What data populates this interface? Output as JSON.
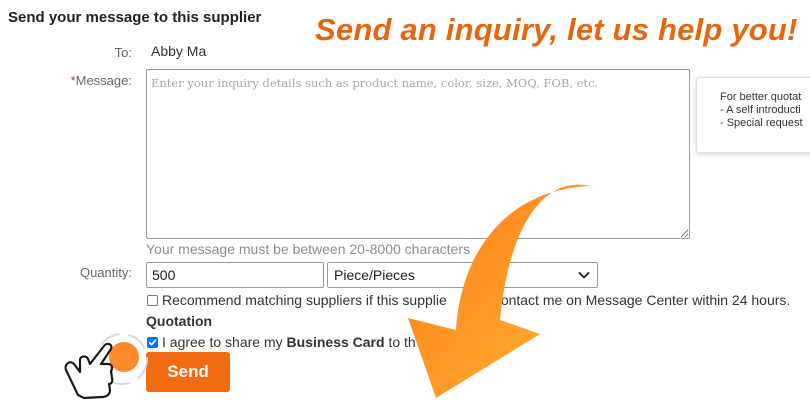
{
  "form": {
    "heading": "Send your message to this supplier",
    "to_label": "To:",
    "to_value": "Abby Ma",
    "message_required_mark": "*",
    "message_label": "Message:",
    "message_placeholder": "Enter your inquiry details such as product name, color, size, MOQ, FOB, etc.",
    "message_hint": "Your message must be between 20-8000 characters",
    "quantity_label": "Quantity:",
    "quantity_value": "500",
    "unit_selected": "Piece/Pieces",
    "recommend_checked": false,
    "recommend_text_1": "Recommend matching suppliers if this supplie",
    "recommend_text_2": "contact me on Message Center within 24 hours.",
    "quotation_title": "Quotation",
    "agree_checked": true,
    "agree_text_1": "I agree to share my",
    "agree_text_bold": "Business Card",
    "agree_text_2": "to th",
    "send_label": "Send"
  },
  "tip": {
    "line1": "For better quotat",
    "line2": "- A self introducti",
    "line3": "- Special request"
  },
  "banner": {
    "slogan": "Send an inquiry, let us help you!"
  },
  "colors": {
    "accent": "#e8650f",
    "send_button": "#f26b12",
    "checkbox_checked": "#0075ff",
    "arrow_start": "#ff7a1a",
    "arrow_end": "#ffb632"
  },
  "icons": {
    "pointer": "hand-pointer-icon",
    "arrow": "curved-arrow-icon",
    "select_caret": "chevron-down-icon"
  }
}
